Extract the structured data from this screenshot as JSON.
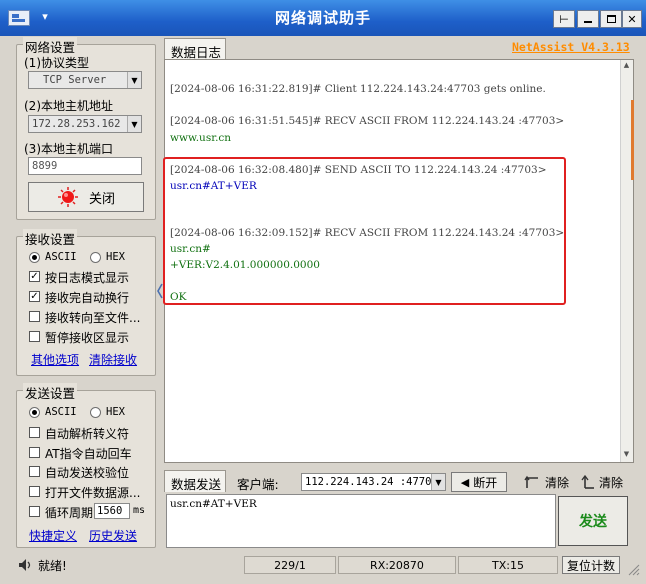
{
  "window": {
    "title": "网络调试助手",
    "chevron": "▾"
  },
  "version": "NetAssist V4.3.13",
  "network": {
    "group_title": "网络设置",
    "protocol_label": "(1)协议类型",
    "protocol_value": "TCP Server",
    "host_label": "(2)本地主机地址",
    "host_value": "172.28.253.162",
    "port_label": "(3)本地主机端口",
    "port_value": "8899",
    "toggle_label": "关闭"
  },
  "recv": {
    "group_title": "接收设置",
    "ascii": "ASCII",
    "hex": "HEX",
    "options": [
      "按日志模式显示",
      "接收完自动换行",
      "接收转向至文件...",
      "暂停接收区显示"
    ],
    "checked": [
      true,
      true,
      false,
      false
    ],
    "more_link": "其他选项",
    "clear_link": "清除接收"
  },
  "send": {
    "group_title": "发送设置",
    "ascii": "ASCII",
    "hex": "HEX",
    "options": [
      "自动解析转义符",
      "AT指令自动回车",
      "自动发送校验位",
      "打开文件数据源..."
    ],
    "cycle_label": "循环周期",
    "cycle_value": "1560",
    "cycle_unit": "ms",
    "shortcut_link": "快捷定义",
    "history_link": "历史发送"
  },
  "log": {
    "tab_label": "数据日志",
    "entries": [
      {
        "head": "[2024-08-06 16:31:22.819]# Client 112.224.143.24:47703 gets online.",
        "body": []
      },
      {
        "head": "[2024-08-06 16:31:51.545]# RECV ASCII FROM 112.224.143.24 :47703>",
        "body": [
          "www.usr.cn"
        ],
        "kind": "recv"
      },
      {
        "head": "[2024-08-06 16:32:08.480]# SEND ASCII TO 112.224.143.24 :47703>",
        "body": [
          "usr.cn#AT+VER"
        ],
        "kind": "send"
      },
      {
        "head": "[2024-08-06 16:32:09.152]# RECV ASCII FROM 112.224.143.24 :47703>",
        "body": [
          "usr.cn#",
          "+VER:V2.4.01.000000.0000",
          "",
          "OK"
        ],
        "kind": "recv"
      }
    ]
  },
  "sendbar": {
    "tab_label": "数据发送",
    "client_label": "客户端:",
    "client_value": "112.224.143.24 :47703",
    "disconnect_label": "断开",
    "clear_label": "清除",
    "clear2_label": "清除",
    "input_value": "usr.cn#AT+VER",
    "send_label": "发送"
  },
  "status": {
    "state": "就绪!",
    "count": "229/1",
    "rx": "RX:20870",
    "tx": "TX:15",
    "reset_label": "复位计数"
  },
  "colors": {
    "title_bar": "#1e5fc9",
    "highlight_border": "#e02020",
    "version": "#ff8c00",
    "send_button": "#1a8a1a"
  }
}
